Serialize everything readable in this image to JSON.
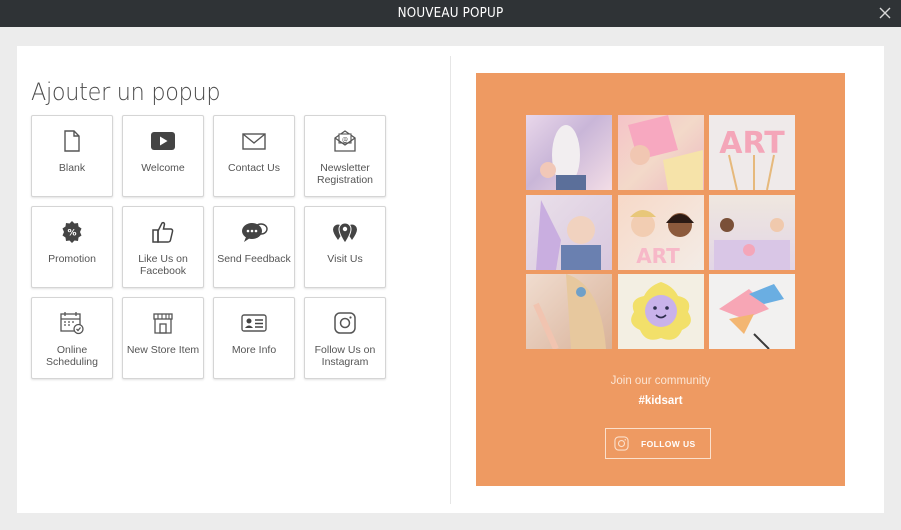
{
  "window": {
    "title": "NOUVEAU POPUP",
    "close_icon": "close-icon"
  },
  "main": {
    "heading": "Ajouter un popup",
    "tiles": [
      {
        "label": "Blank",
        "icon": "document-icon"
      },
      {
        "label": "Welcome",
        "icon": "play-video-icon"
      },
      {
        "label": "Contact Us",
        "icon": "envelope-icon"
      },
      {
        "label": "Newsletter Registration",
        "icon": "newsletter-envelope-icon"
      },
      {
        "label": "Promotion",
        "icon": "percent-badge-icon"
      },
      {
        "label": "Like Us on Facebook",
        "icon": "thumbs-up-icon"
      },
      {
        "label": "Send Feedback",
        "icon": "chat-bubbles-icon"
      },
      {
        "label": "Visit Us",
        "icon": "map-pins-icon"
      },
      {
        "label": "Online Scheduling",
        "icon": "calendar-check-icon"
      },
      {
        "label": "New Store Item",
        "icon": "storefront-icon"
      },
      {
        "label": "More Info",
        "icon": "id-card-icon"
      },
      {
        "label": "Follow Us on Instagram",
        "icon": "instagram-icon"
      }
    ]
  },
  "preview": {
    "background": "#ee9a62",
    "community_text": "Join our community",
    "hashtag": "#kidsart",
    "button_label": "FOLLOW US",
    "button_icon": "instagram-icon",
    "photo_letters": [
      "ART",
      "ART"
    ]
  }
}
